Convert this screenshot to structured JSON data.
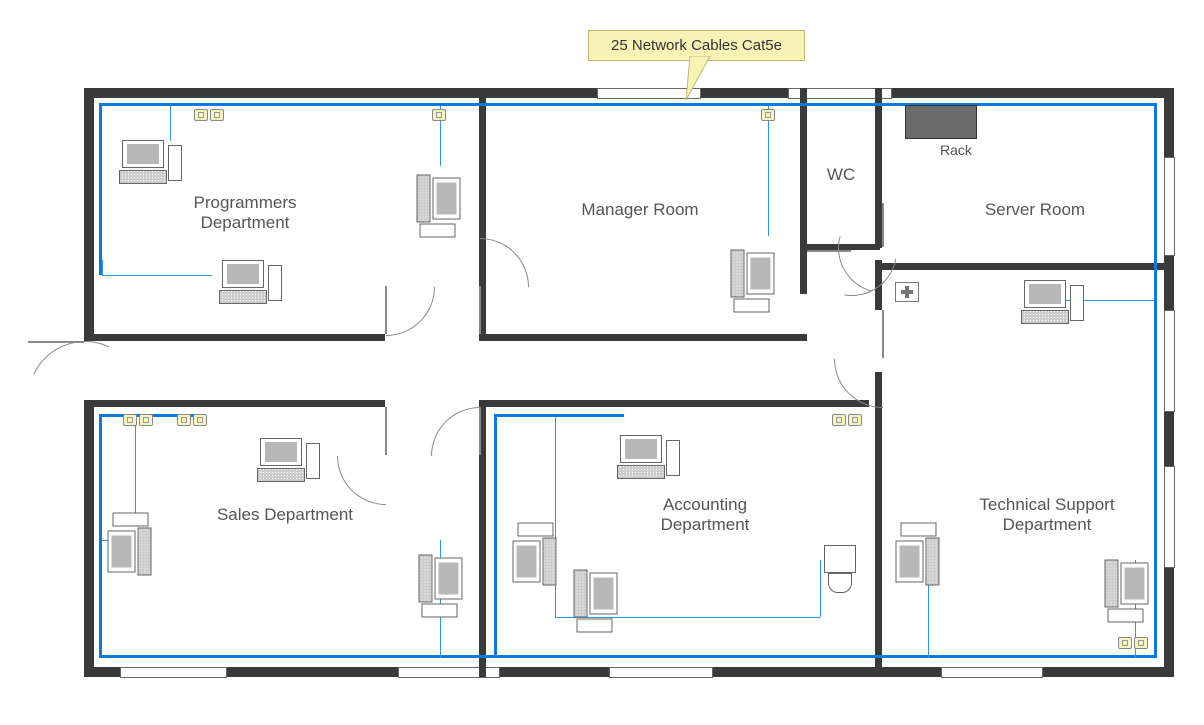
{
  "callout": {
    "text": "25 Network Cables Cat5e"
  },
  "rooms": {
    "programmers": "Programmers\nDepartment",
    "manager": "Manager Room",
    "wc": "WC",
    "server": "Server Room",
    "sales": "Sales Department",
    "accounting": "Accounting\nDepartment",
    "techsupport": "Technical Support\nDepartment"
  },
  "equipment": {
    "rack_label": "Rack"
  }
}
